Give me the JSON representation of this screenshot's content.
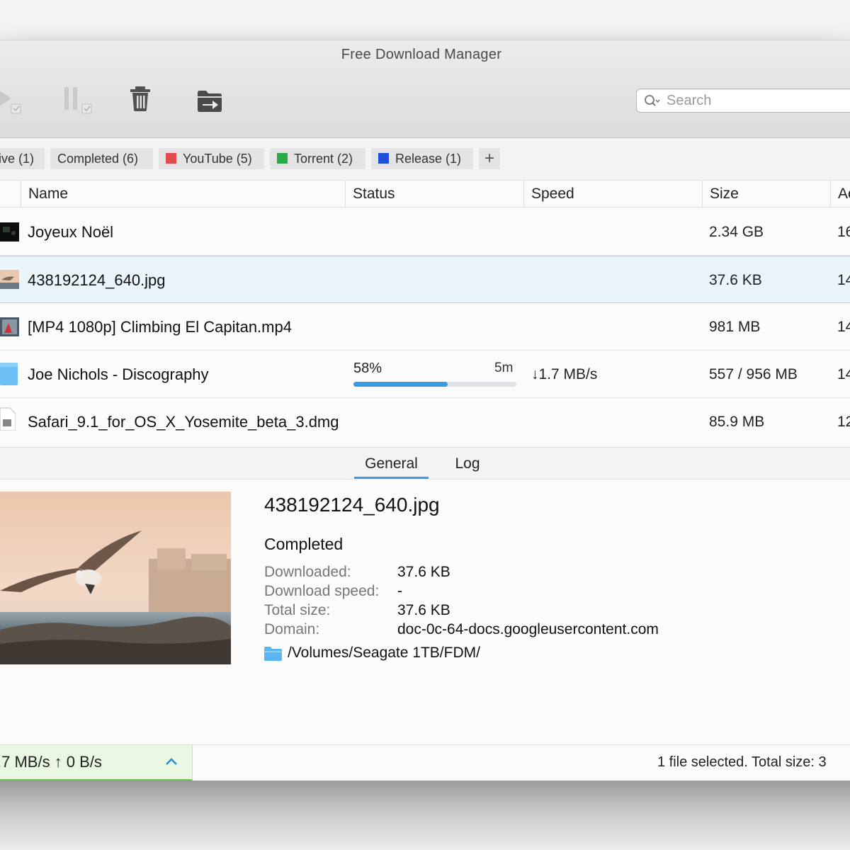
{
  "window": {
    "title": "Free Download Manager"
  },
  "toolbar": {
    "search_placeholder": "Search"
  },
  "tags": {
    "active": "ive (1)",
    "completed": "Completed (6)",
    "youtube": "YouTube (5)",
    "torrent": "Torrent (2)",
    "release": "Release (1)",
    "add": "+",
    "colors": {
      "youtube": "#e24b4b",
      "torrent": "#2aa84a",
      "release": "#1f4fd6"
    }
  },
  "columns": {
    "name": "Name",
    "status": "Status",
    "speed": "Speed",
    "size": "Size",
    "added": "Ac"
  },
  "downloads": [
    {
      "name": "Joyeux Noël",
      "size": "2.34 GB",
      "added": "16"
    },
    {
      "name": "438192124_640.jpg",
      "size": "37.6 KB",
      "added": "14",
      "selected": true
    },
    {
      "name": "[MP4 1080p] Climbing El Capitan.mp4",
      "size": "981 MB",
      "added": "14"
    },
    {
      "name": "Joe Nichols - Discography",
      "size": "557 / 956 MB",
      "added": "14",
      "status_percent": "58%",
      "progress": 0.58,
      "eta": "5m",
      "speed": "↓1.7 MB/s"
    },
    {
      "name": "Safari_9.1_for_OS_X_Yosemite_beta_3.dmg",
      "size": "85.9 MB",
      "added": "12"
    }
  ],
  "detail": {
    "tabs": {
      "general": "General",
      "log": "Log"
    },
    "filename": "438192124_640.jpg",
    "state": "Completed",
    "fields": {
      "downloaded_label": "Downloaded:",
      "downloaded_value": "37.6 KB",
      "speed_label": "Download speed:",
      "speed_value": "-",
      "total_label": "Total size:",
      "total_value": "37.6 KB",
      "domain_label": "Domain:",
      "domain_value": "doc-0c-64-docs.googleusercontent.com"
    },
    "path": "/Volumes/Seagate 1TB/FDM/"
  },
  "statusbar": {
    "speeds": ".7 MB/s ↑ 0 B/s",
    "summary": "1 file selected. Total size: 3"
  }
}
